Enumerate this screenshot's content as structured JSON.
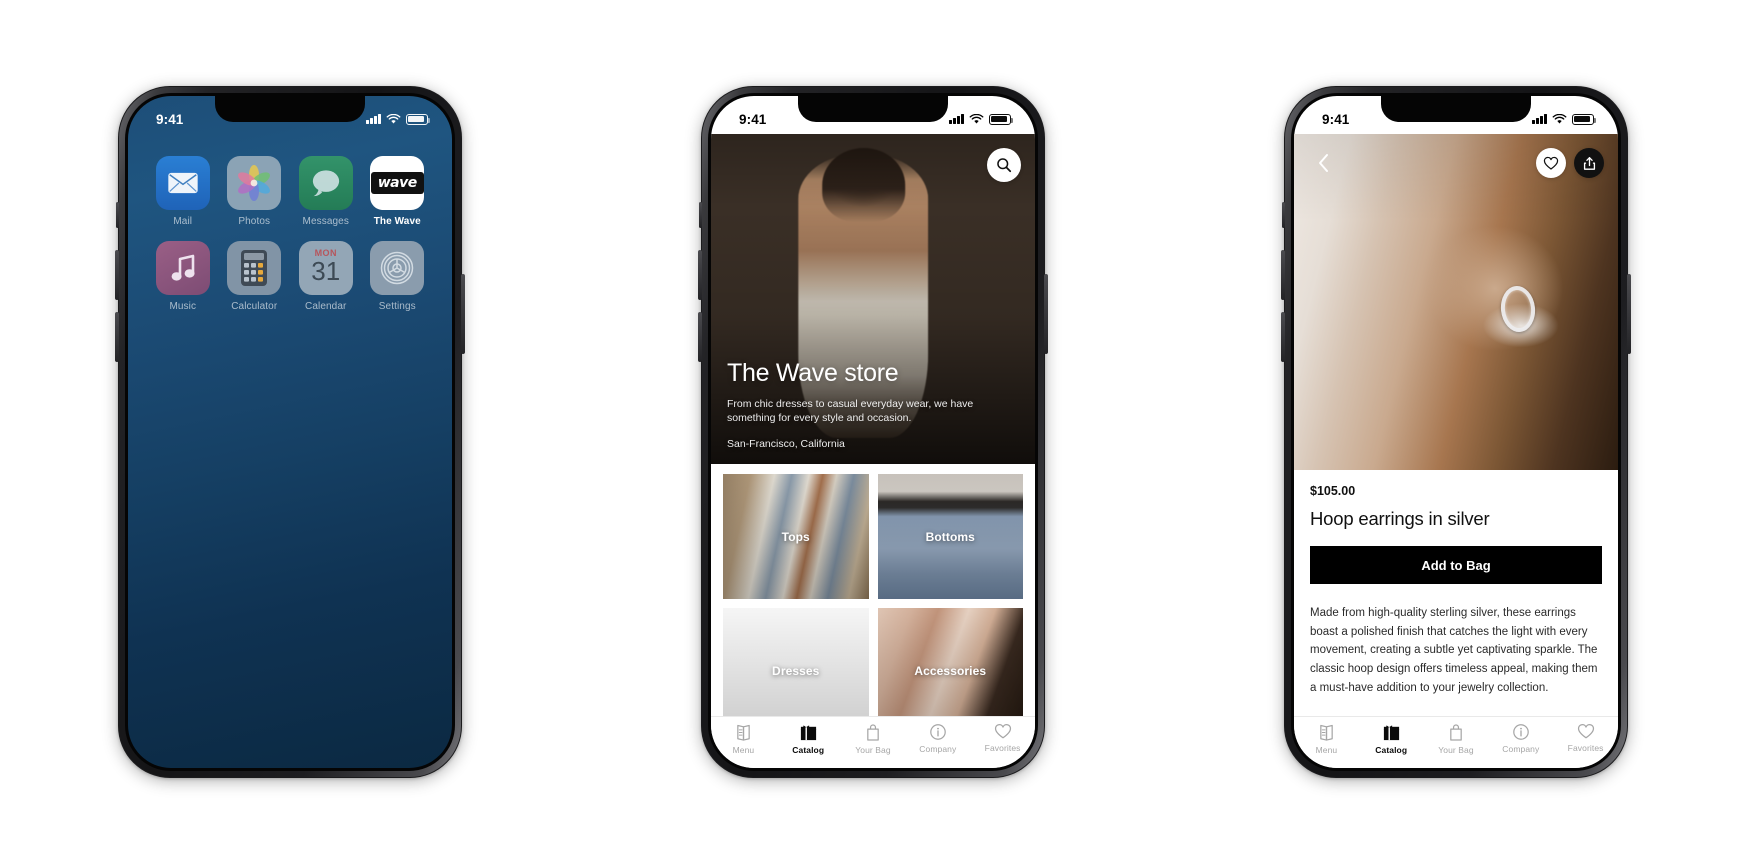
{
  "statusbar": {
    "time": "9:41",
    "cellular_icon": "cellular-signal-icon",
    "wifi_icon": "wifi-icon",
    "battery_icon": "battery-icon"
  },
  "phone1": {
    "apps_row1": [
      {
        "label": "Mail",
        "icon": "mail-icon"
      },
      {
        "label": "Photos",
        "icon": "photos-icon"
      },
      {
        "label": "Messages",
        "icon": "messages-icon"
      },
      {
        "label": "The Wave",
        "icon": "wave-app-icon",
        "badge_text": "wave",
        "highlight": true
      }
    ],
    "apps_row2": [
      {
        "label": "Music",
        "icon": "music-icon"
      },
      {
        "label": "Calculator",
        "icon": "calculator-icon"
      },
      {
        "label": "Calendar",
        "icon": "calendar-icon",
        "weekday": "MON",
        "day": "31"
      },
      {
        "label": "Settings",
        "icon": "settings-gear-icon"
      }
    ]
  },
  "phone2": {
    "search_icon": "search-icon",
    "hero": {
      "title": "The Wave store",
      "subtitle": "From chic dresses to casual everyday wear, we have something for every style and occasion.",
      "location": "San-Francisco, California"
    },
    "categories": [
      {
        "label": "Tops"
      },
      {
        "label": "Bottoms"
      },
      {
        "label": "Dresses"
      },
      {
        "label": "Accessories"
      }
    ]
  },
  "phone3": {
    "back_icon": "chevron-left-icon",
    "favorite_icon": "heart-icon",
    "share_icon": "share-icon",
    "product": {
      "price": "$105.00",
      "title": "Hoop earrings in silver",
      "add_to_bag_label": "Add to Bag",
      "description": "Made from high-quality sterling silver, these earrings boast a polished finish that catches the light with every movement, creating a subtle yet captivating sparkle. The classic hoop design offers timeless appeal, making them a must-have addition to your jewelry collection."
    }
  },
  "tabbar": {
    "items": [
      {
        "label": "Menu",
        "icon": "menu-document-icon",
        "active": false
      },
      {
        "label": "Catalog",
        "icon": "catalog-box-icon",
        "active": true
      },
      {
        "label": "Your Bag",
        "icon": "shopping-bag-icon",
        "active": false
      },
      {
        "label": "Company",
        "icon": "info-circle-icon",
        "active": false
      },
      {
        "label": "Favorites",
        "icon": "heart-icon",
        "active": false
      }
    ]
  },
  "colors": {
    "accent": "#000000",
    "page_bg": "#ffffff",
    "home_bg": "#17456d",
    "muted": "#a6a6a6"
  }
}
